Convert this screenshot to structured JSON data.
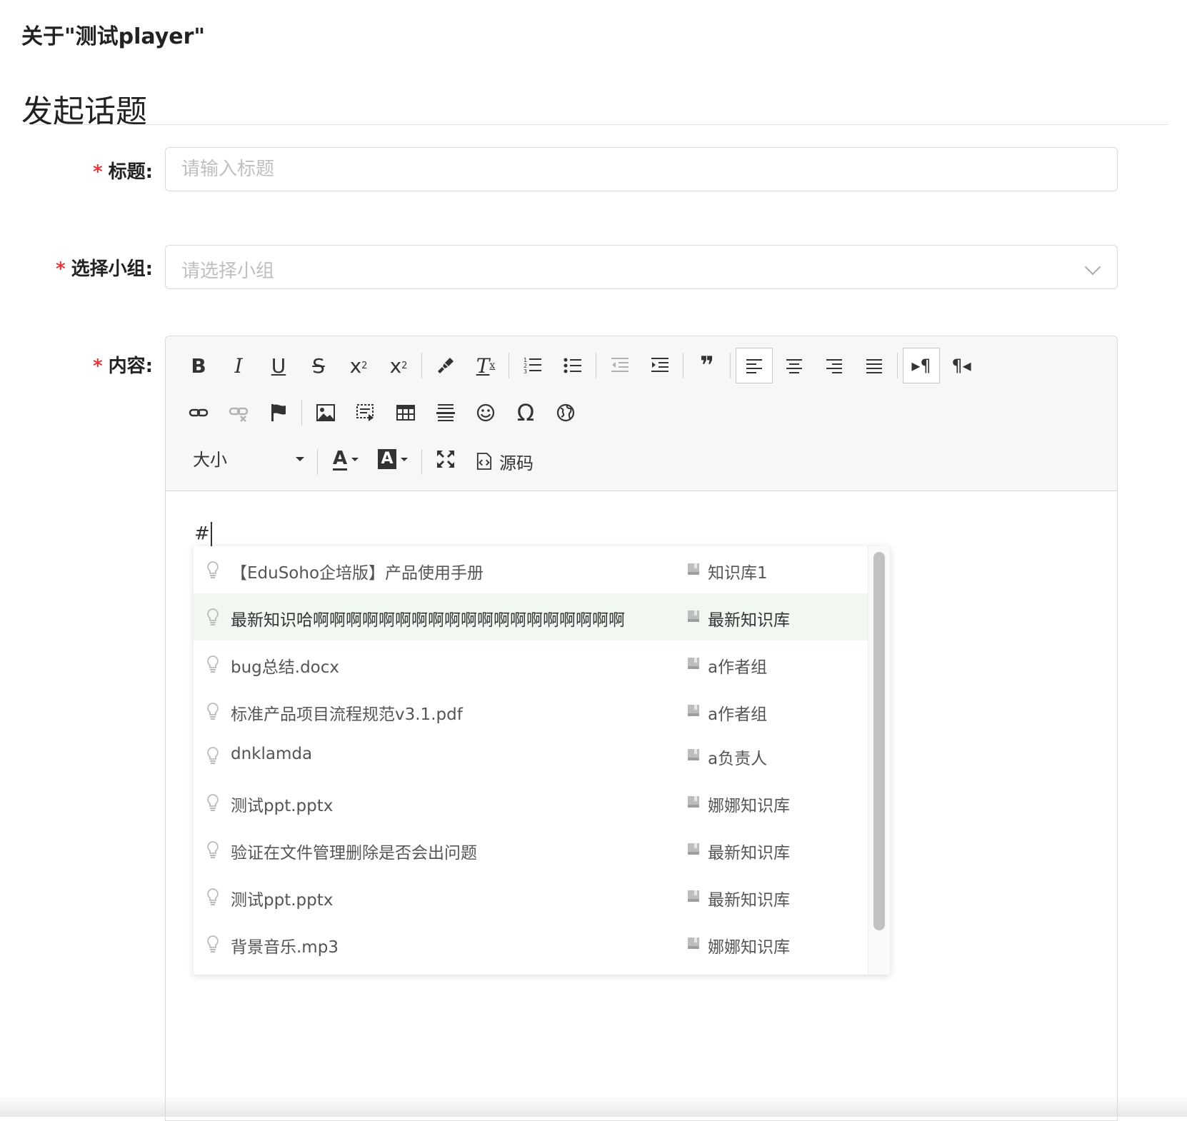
{
  "breadcrumb": "关于\"测试player\"",
  "page_title": "发起话题",
  "form": {
    "title": {
      "required_mark": "*",
      "label": "标题:",
      "placeholder": "请输入标题"
    },
    "group": {
      "required_mark": "*",
      "label": "选择小组:",
      "placeholder": "请选择小组"
    },
    "content": {
      "required_mark": "*",
      "label": "内容:"
    }
  },
  "toolbar": {
    "bold": "B",
    "italic": "I",
    "underline": "U",
    "strike": "S",
    "subscript": "x",
    "subscript_small": "2",
    "superscript": "x",
    "superscript_small": "2",
    "remove_format": "T",
    "remove_format_small": "x",
    "blockquote": "❞",
    "ltr": "▸¶",
    "rtl": "¶◂",
    "special_char": "Ω",
    "size_label": "大小",
    "font_color": "A",
    "bg_color": "A",
    "source_label": "源码"
  },
  "editor": {
    "content": "#"
  },
  "suggestions": [
    {
      "title": "【EduSoho企培版】产品使用手册",
      "kb": "知识库1"
    },
    {
      "title": "最新知识哈啊啊啊啊啊啊啊啊啊啊啊啊啊啊啊啊啊啊啊",
      "kb": "最新知识库",
      "highlight": true
    },
    {
      "title": "bug总结.docx",
      "kb": "a作者组"
    },
    {
      "title": "标准产品项目流程规范v3.1.pdf",
      "kb": "a作者组"
    },
    {
      "title": "dnklamda",
      "kb": "a负责人"
    },
    {
      "title": "测试ppt.pptx",
      "kb": "娜娜知识库"
    },
    {
      "title": "验证在文件管理删除是否会出问题",
      "kb": "最新知识库"
    },
    {
      "title": "测试ppt.pptx",
      "kb": "最新知识库"
    },
    {
      "title": "背景音乐.mp3",
      "kb": "娜娜知识库"
    }
  ],
  "colors": {
    "required": "#e4393c",
    "highlight_row": "#f1f8f1",
    "border": "#d9d9d9"
  }
}
